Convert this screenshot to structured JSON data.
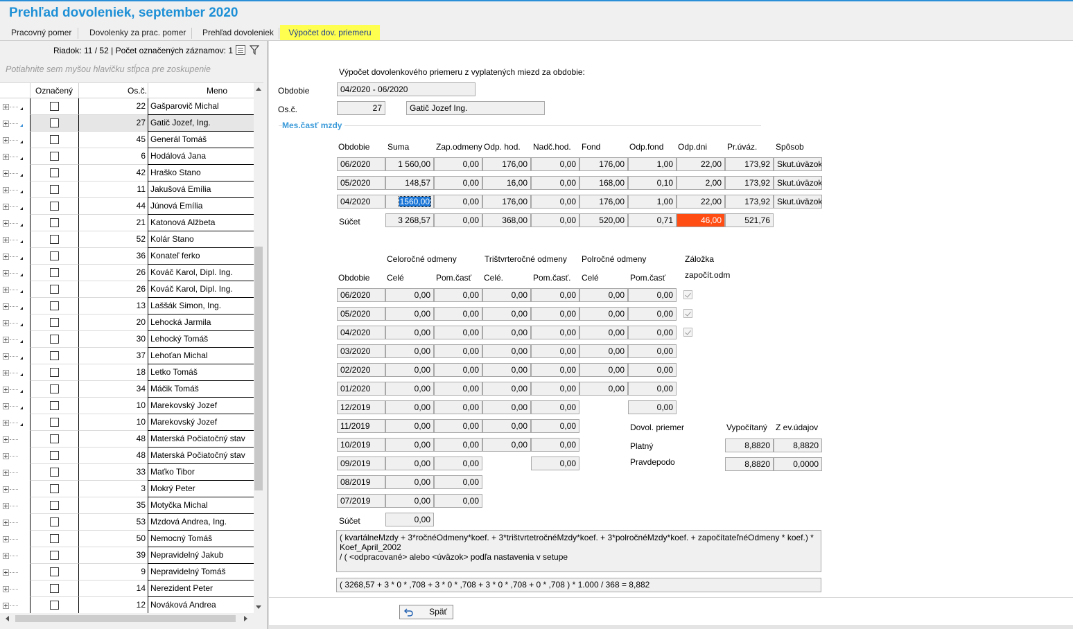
{
  "title": "Prehľad dovoleniek, september 2020",
  "tabs": [
    "Pracovný pomer",
    "Dovolenky za prac. pomer",
    "Prehľad dovoleniek",
    "Výpočet dov. priemeru"
  ],
  "left": {
    "info": "Riadok: 11 / 52 | Počet označených záznamov: 1",
    "group_hint": "Potiahnite sem myšou hlavičku stĺpca pre zoskupenie",
    "columns": [
      "Označený",
      "Os.č.",
      "Meno"
    ],
    "rows": [
      {
        "id": "22",
        "name": "Gašparovič Michal"
      },
      {
        "id": "27",
        "name": "Gatič Jozef, Ing."
      },
      {
        "id": "45",
        "name": "Generál Tomáš"
      },
      {
        "id": "6",
        "name": "Hodálová Jana"
      },
      {
        "id": "42",
        "name": "Hraško Stano"
      },
      {
        "id": "11",
        "name": "Jakušová Emília"
      },
      {
        "id": "44",
        "name": "Júnová Emília"
      },
      {
        "id": "21",
        "name": "Katonová Alžbeta"
      },
      {
        "id": "52",
        "name": "Kolár Stano"
      },
      {
        "id": "36",
        "name": "Konateľ ferko"
      },
      {
        "id": "26",
        "name": "Kováč Karol, Dipl. Ing."
      },
      {
        "id": "26",
        "name": "Kováč Karol, Dipl. Ing."
      },
      {
        "id": "13",
        "name": "Laššák Simon, Ing."
      },
      {
        "id": "20",
        "name": "Lehocká Jarmila"
      },
      {
        "id": "30",
        "name": "Lehocký Tomáš"
      },
      {
        "id": "37",
        "name": "Lehoťan Michal"
      },
      {
        "id": "18",
        "name": "Letko Tomáš"
      },
      {
        "id": "34",
        "name": "Máčik Tomáš"
      },
      {
        "id": "10",
        "name": "Marekovský Jozef"
      },
      {
        "id": "10",
        "name": "Marekovský Jozef"
      },
      {
        "id": "48",
        "name": "Materská Počiatočný stav"
      },
      {
        "id": "48",
        "name": "Materská Počiatočný stav"
      },
      {
        "id": "33",
        "name": "Maťko Tibor"
      },
      {
        "id": "3",
        "name": "Mokrý Peter"
      },
      {
        "id": "35",
        "name": "Motyčka Michal"
      },
      {
        "id": "53",
        "name": "Mzdová Andrea, Ing."
      },
      {
        "id": "50",
        "name": "Nemocný Tomáš"
      },
      {
        "id": "39",
        "name": "Nepravidelný Jakub"
      },
      {
        "id": "9",
        "name": "Nepravidelný Tomáš"
      },
      {
        "id": "14",
        "name": "Nerezident Peter"
      },
      {
        "id": "12",
        "name": "Nováková Andrea"
      }
    ]
  },
  "right": {
    "heading": "Výpočet dovolenkového priemeru z vyplatených miezd za obdobie:",
    "obdobie_label": "Obdobie",
    "obdobie_value": "04/2020 - 06/2020",
    "osc_label": "Os.č.",
    "osc_value": "27",
    "osc_name": "Gatič Jozef Ing.",
    "section_title": "Mes.časť mzdy",
    "mzdy_headers": [
      "Obdobie",
      "Suma",
      "Zap.odmeny",
      "Odp. hod.",
      "Nadč.hod.",
      "Fond",
      "Odp.fond",
      "Odp.dni",
      "Pr.úváz.",
      "Spôsob"
    ],
    "mzdy_rows": [
      [
        "06/2020",
        "1 560,00",
        "0,00",
        "176,00",
        "0,00",
        "176,00",
        "1,00",
        "22,00",
        "173,92",
        "Skut.úväzok"
      ],
      [
        "05/2020",
        "148,57",
        "0,00",
        "16,00",
        "0,00",
        "168,00",
        "0,10",
        "2,00",
        "173,92",
        "Skut.úväzok"
      ],
      [
        "04/2020",
        "1560,00",
        "0,00",
        "176,00",
        "0,00",
        "176,00",
        "1,00",
        "22,00",
        "173,92",
        "Skut.úväzok"
      ]
    ],
    "mzdy_sum": [
      "Súčet",
      "3 268,57",
      "0,00",
      "368,00",
      "0,00",
      "520,00",
      "0,71",
      "46,00",
      "521,76"
    ],
    "odm_group_headers": [
      "Celoročné odmeny",
      "Trištvrteročné odmeny",
      "Polročné odmeny",
      "Záložka"
    ],
    "odm_headers": [
      "Obdobie",
      "Celé",
      "Pom.časť",
      "Celé.",
      "Pom.časť.",
      "Celé",
      "Pom.časť",
      "započít.odm"
    ],
    "odm_rows": [
      {
        "period": "06/2020",
        "vals": [
          "0,00",
          "0,00",
          "0,00",
          "0,00",
          "0,00",
          "0,00"
        ]
      },
      {
        "period": "05/2020",
        "vals": [
          "0,00",
          "0,00",
          "0,00",
          "0,00",
          "0,00",
          "0,00"
        ]
      },
      {
        "period": "04/2020",
        "vals": [
          "0,00",
          "0,00",
          "0,00",
          "0,00",
          "0,00",
          "0,00"
        ]
      },
      {
        "period": "03/2020",
        "vals": [
          "0,00",
          "0,00",
          "0,00",
          "0,00",
          "0,00",
          "0,00"
        ]
      },
      {
        "period": "02/2020",
        "vals": [
          "0,00",
          "0,00",
          "0,00",
          "0,00",
          "0,00",
          "0,00"
        ]
      },
      {
        "period": "01/2020",
        "vals": [
          "0,00",
          "0,00",
          "0,00",
          "0,00",
          "0,00",
          "0,00"
        ]
      },
      {
        "period": "12/2019",
        "vals": [
          "0,00",
          "0,00",
          "0,00",
          "0,00",
          "0,00"
        ]
      },
      {
        "period": "11/2019",
        "vals": [
          "0,00",
          "0,00",
          "0,00",
          "0,00"
        ]
      },
      {
        "period": "10/2019",
        "vals": [
          "0,00",
          "0,00",
          "0,00",
          "0,00"
        ]
      },
      {
        "period": "09/2019",
        "vals": [
          "0,00",
          "0,00",
          "0,00"
        ]
      },
      {
        "period": "08/2019",
        "vals": [
          "0,00",
          "0,00"
        ]
      },
      {
        "period": "07/2019",
        "vals": [
          "0,00",
          "0,00"
        ]
      }
    ],
    "odm_sum_label": "Súčet",
    "odm_sum_value": "0,00",
    "priemer": {
      "label": "Dovol. priemer",
      "col1": "Vypočítaný",
      "col2": "Z ev.údajov",
      "platny_label": "Platný",
      "platny_vyp": "8,8820",
      "platny_ev": "8,8820",
      "pravdepodo_label": "Pravdepodo",
      "pravdepodo_vyp": "8,8820",
      "pravdepodo_ev": "0,0000"
    },
    "formula_line1": "( kvartálneMzdy + 3*ročnéOdmeny*koef. + 3*trištvrtetročnéMzdy*koef. + 3*polročnéMzdy*koef. + započítateľnéOdmeny * koef.) * Koef_April_2002",
    "formula_line2": "/ ( <odpracované> alebo <úväzok> podľa nastavenia v setupe",
    "formula_result": "( 3268,57 + 3 * 0 * ,708 + 3 * 0 * ,708 + 3 * 0 * ,708 + 0 * ,708 ) *  1.000 / 368 = 8,882",
    "back_button": "Späť"
  }
}
